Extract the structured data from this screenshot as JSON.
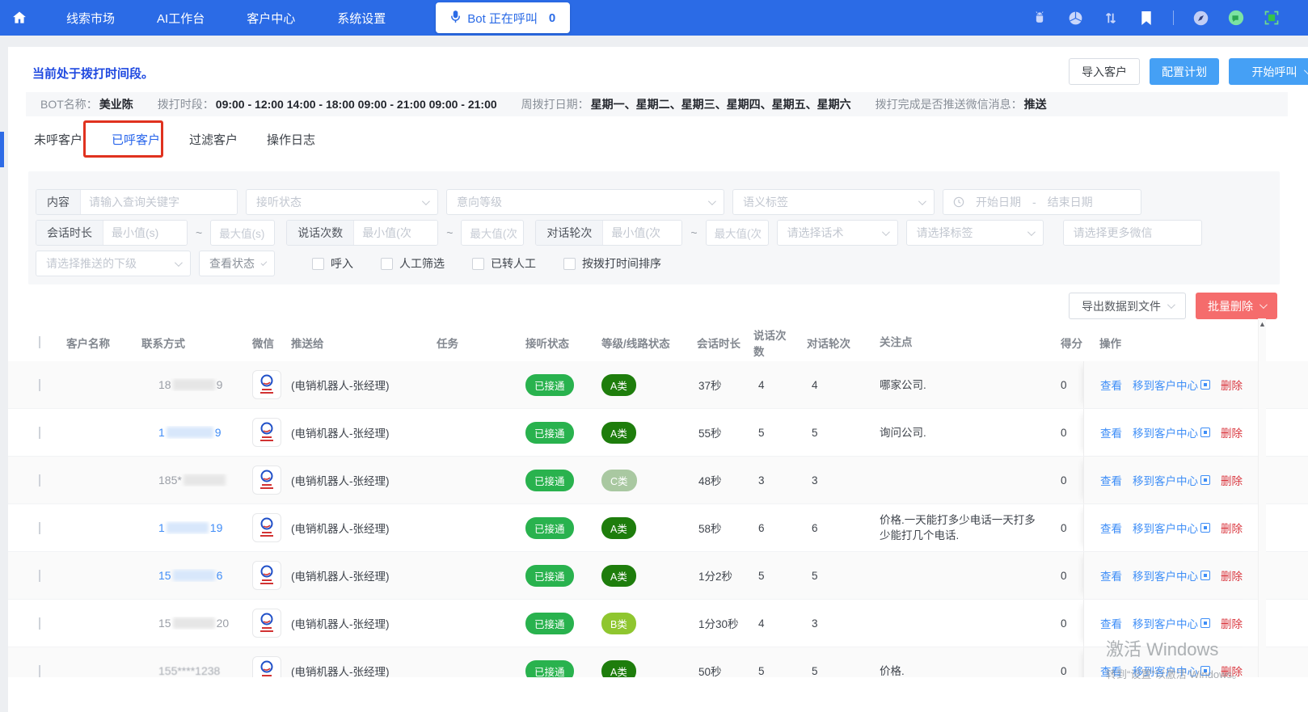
{
  "colors": {
    "navbar": "#2b6be6",
    "primary_button": "#45a0f5",
    "danger_button": "#f56c6c",
    "status_green": "#29b24e",
    "level_a": "#1e7d0c",
    "level_b": "#8fc62f",
    "level_c": "#a9c8a1",
    "link": "#3e8ef7",
    "link_danger": "#d9363e",
    "active_tab": "#2563eb",
    "annotation_red": "#e0321f",
    "status_text_blue": "#1f49e0"
  },
  "navbar": {
    "menu": [
      "线索市场",
      "AI工作台",
      "客户中心",
      "系统设置"
    ],
    "bot_button": {
      "label": "Bot 正在呼叫",
      "count": "0"
    },
    "right_icons": [
      "android-icon",
      "aperture-icon",
      "sort-arrows-icon",
      "bookmark-icon",
      "compass-icon",
      "wechat-icon",
      "fullscreen-icon"
    ]
  },
  "header": {
    "status_text": "当前处于拨打时间段。",
    "import_label": "导入客户",
    "configure_label": "配置计划",
    "start_call_label": "开始呼叫"
  },
  "bot_info": {
    "items": [
      {
        "label": "BOT名称：",
        "value": "美业陈"
      },
      {
        "label": "拨打时段：",
        "value": "09:00 - 12:00 14:00 - 18:00 09:00 - 21:00 09:00 - 21:00"
      },
      {
        "label": "周拨打日期：",
        "value": "星期一、星期二、星期三、星期四、星期五、星期六"
      },
      {
        "label": "拨打完成是否推送微信消息：",
        "value": "推送"
      }
    ]
  },
  "tabs": [
    {
      "label": "未呼客户",
      "active": false
    },
    {
      "label": "已呼客户",
      "active": true
    },
    {
      "label": "过滤客户",
      "active": false
    },
    {
      "label": "操作日志",
      "active": false
    }
  ],
  "filters": {
    "row1": {
      "content_label": "内容",
      "content_placeholder": "请输入查询关键字",
      "listen_status": "接听状态",
      "intent_level": "意向等级",
      "semantic_tag": "语义标签",
      "start_date": "开始日期",
      "date_sep": "-",
      "end_date": "结束日期"
    },
    "row2": {
      "duration_label": "会话时长",
      "duration_min": "最小值(s)",
      "duration_max": "最大值(s)",
      "speak_label": "说话次数",
      "speak_min": "最小值(次",
      "speak_max": "最大值(次",
      "rounds_label": "对话轮次",
      "rounds_min": "最小值(次",
      "rounds_max": "最大值(次",
      "tilde": "~",
      "script_select": "请选择话术",
      "tag_select": "请选择标签",
      "wechat_select": "请选择更多微信"
    },
    "row3": {
      "push_sub_select": "请选择推送的下级",
      "view_status_select": "查看状态",
      "checkboxes": [
        "呼入",
        "人工筛选",
        "已转人工",
        "按拨打时间排序"
      ]
    }
  },
  "toolbar": {
    "export_label": "导出数据到文件",
    "batch_delete_label": "批量删除"
  },
  "table": {
    "columns": [
      "客户名称",
      "联系方式",
      "微信",
      "推送给",
      "任务",
      "接听状态",
      "等级/线路状态",
      "会话时长",
      "说话次数",
      "对话轮次",
      "关注点",
      "得分",
      "操作"
    ],
    "actions": {
      "view": "查看",
      "move": "移到客户中心",
      "del": "删除"
    },
    "rows": [
      {
        "phone": {
          "pre": "18",
          "suf": "9",
          "style": "gray",
          "blur": 52
        },
        "push": "(电销机器人-张经理)",
        "status": "已接通",
        "level": "A类",
        "grade": "A",
        "duration": "37秒",
        "speak": "4",
        "rounds": "4",
        "focus": "哪家公司.",
        "score": "0"
      },
      {
        "phone": {
          "pre": "1",
          "suf": "9",
          "style": "blue",
          "blur": 58
        },
        "push": "(电销机器人-张经理)",
        "status": "已接通",
        "level": "A类",
        "grade": "A",
        "duration": "55秒",
        "speak": "5",
        "rounds": "5",
        "focus": "询问公司.",
        "score": "0"
      },
      {
        "phone": {
          "pre": "185*",
          "suf": "",
          "style": "gray",
          "blur": 52
        },
        "push": "(电销机器人-张经理)",
        "status": "已接通",
        "level": "C类",
        "grade": "C",
        "duration": "48秒",
        "speak": "3",
        "rounds": "3",
        "focus": "",
        "score": "0"
      },
      {
        "phone": {
          "pre": "1",
          "suf": "19",
          "style": "blue",
          "blur": 52
        },
        "push": "(电销机器人-张经理)",
        "status": "已接通",
        "level": "A类",
        "grade": "A",
        "duration": "58秒",
        "speak": "6",
        "rounds": "6",
        "focus": "价格.一天能打多少电话一天打多少能打几个电话.",
        "score": "0"
      },
      {
        "phone": {
          "pre": "15",
          "suf": "6",
          "style": "blue",
          "blur": 52
        },
        "push": "(电销机器人-张经理)",
        "status": "已接通",
        "level": "A类",
        "grade": "A",
        "duration": "1分2秒",
        "speak": "5",
        "rounds": "5",
        "focus": "",
        "score": "0"
      },
      {
        "phone": {
          "pre": "15",
          "suf": "20",
          "style": "gray",
          "blur": 52
        },
        "push": "(电销机器人-张经理)",
        "status": "已接通",
        "level": "B类",
        "grade": "B",
        "duration": "1分30秒",
        "speak": "4",
        "rounds": "3",
        "focus": "",
        "score": "0"
      },
      {
        "phone": {
          "pre": "155****1238",
          "suf": "",
          "style": "gray",
          "soft": true
        },
        "push": "(电销机器人-张经理)",
        "status": "已接通",
        "level": "A类",
        "grade": "A",
        "duration": "50秒",
        "speak": "5",
        "rounds": "5",
        "focus": "价格.",
        "score": "0"
      }
    ]
  },
  "watermark": {
    "line1": "激活 Windows",
    "line2": "转到“设置”以激活 Windows。"
  }
}
